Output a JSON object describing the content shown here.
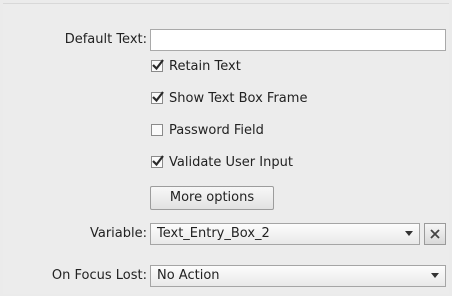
{
  "fields": {
    "default_text_label": "Default Text:",
    "default_text_value": "",
    "variable_label": "Variable:",
    "variable_value": "Text_Entry_Box_2",
    "on_focus_lost_label": "On Focus Lost:",
    "on_focus_lost_value": "No Action"
  },
  "checkboxes": {
    "retain_text": {
      "label": "Retain Text",
      "checked": true
    },
    "show_frame": {
      "label": "Show Text Box Frame",
      "checked": true
    },
    "password": {
      "label": "Password Field",
      "checked": false
    },
    "validate": {
      "label": "Validate User Input",
      "checked": true
    }
  },
  "buttons": {
    "more_options": "More options"
  },
  "icons": {
    "clear_variable": "x-icon",
    "dropdown": "chevron-down-icon"
  }
}
